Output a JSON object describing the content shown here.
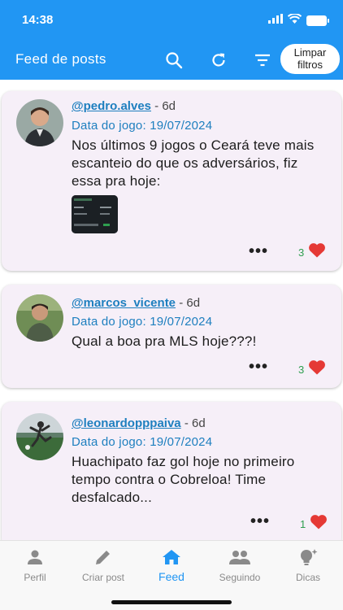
{
  "status": {
    "time": "14:38"
  },
  "toolbar": {
    "title": "Feed de posts",
    "search_icon": "search-icon",
    "refresh_icon": "refresh-icon",
    "filter_icon": "filter-icon",
    "clear_label_1": "Limpar",
    "clear_label_2": "filtros"
  },
  "posts": [
    {
      "handle": "@pedro.alves",
      "ago": "- 6d",
      "game_date": "Data do jogo: 19/07/2024",
      "text": "Nos últimos 9 jogos o Ceará teve mais escanteio do que os adversários, fiz essa pra hoje:",
      "has_image": true,
      "more": "•••",
      "likes": "3"
    },
    {
      "handle": "@marcos_vicente",
      "ago": "- 6d",
      "game_date": "Data do jogo: 19/07/2024",
      "text": "Qual a boa pra MLS hoje???!",
      "more": "•••",
      "likes": "3"
    },
    {
      "handle": "@leonardopppaiva",
      "ago": "- 6d",
      "game_date": "Data do jogo: 19/07/2024",
      "text": "Huachipato faz gol hoje no primeiro tempo contra o Cobreloa! Time desfalcado...",
      "more": "•••",
      "likes": "1"
    }
  ],
  "nav": {
    "profile": "Perfil",
    "create": "Criar post",
    "feed": "Feed",
    "following": "Seguindo",
    "tips": "Dicas"
  },
  "colors": {
    "primary": "#2196f3",
    "heart": "#e53935",
    "link": "#1e7fbf"
  }
}
